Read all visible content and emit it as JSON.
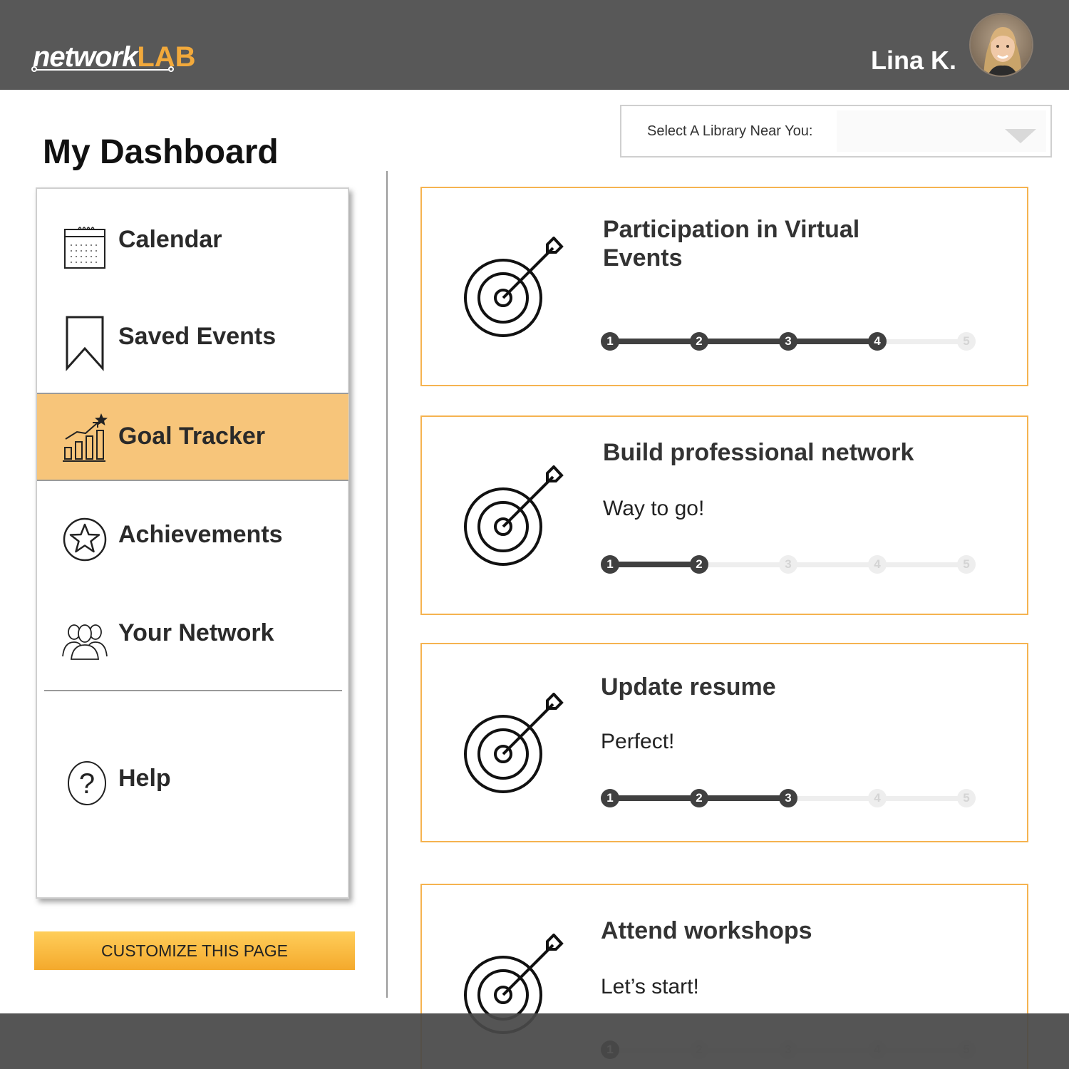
{
  "header": {
    "logo_primary": "network",
    "logo_accent": "LAB",
    "user_name": "Lina K.",
    "brand_color": "#f2a93b",
    "bar_color": "#585858"
  },
  "page": {
    "title": "My Dashboard"
  },
  "library_select": {
    "label": "Select A Library Near You:",
    "value": ""
  },
  "sidebar": {
    "items": [
      {
        "label": "Calendar",
        "icon": "calendar-icon",
        "active": false
      },
      {
        "label": "Saved Events",
        "icon": "bookmark-icon",
        "active": false
      },
      {
        "label": "Goal Tracker",
        "icon": "growth-chart-icon",
        "active": true
      },
      {
        "label": "Achievements",
        "icon": "star-badge-icon",
        "active": false
      },
      {
        "label": "Your Network",
        "icon": "people-icon",
        "active": false
      },
      {
        "label": "Help",
        "icon": "question-icon",
        "active": false
      }
    ],
    "active_color": "#f7c57a"
  },
  "customize_label": "CUSTOMIZE THIS PAGE",
  "goals": [
    {
      "title": "Participation in Virtual Events",
      "message": "",
      "progress": 4,
      "total": 5
    },
    {
      "title": "Build professional network",
      "message": "Way to go!",
      "progress": 2,
      "total": 5
    },
    {
      "title": "Update resume",
      "message": "Perfect!",
      "progress": 3,
      "total": 5
    },
    {
      "title": "Attend workshops",
      "message": "Let’s start!",
      "progress": 1,
      "total": 5
    }
  ],
  "step_labels": [
    "1",
    "2",
    "3",
    "4",
    "5"
  ]
}
